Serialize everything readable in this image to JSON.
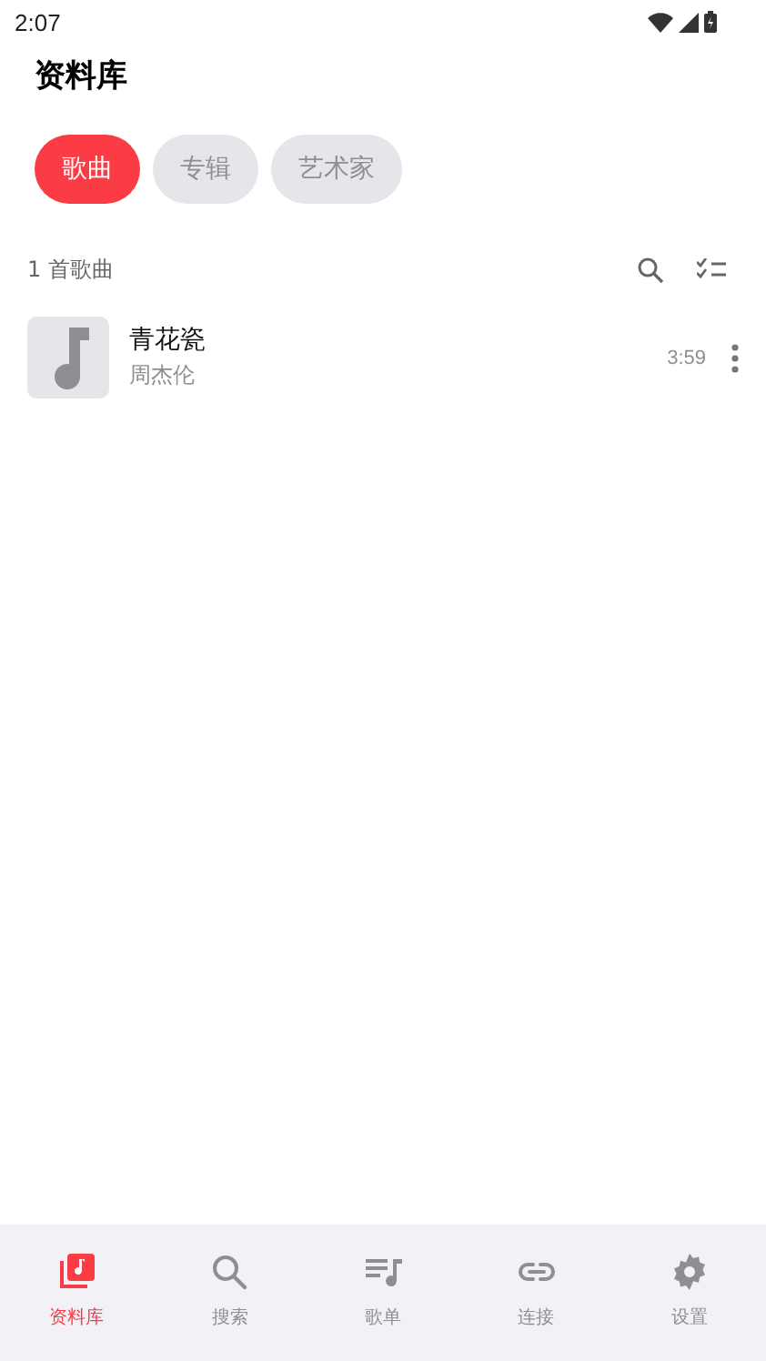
{
  "status_bar": {
    "time": "2:07"
  },
  "title": "资料库",
  "chips": [
    {
      "label": "歌曲",
      "selected": true
    },
    {
      "label": "专辑",
      "selected": false
    },
    {
      "label": "艺术家",
      "selected": false
    }
  ],
  "list_header": {
    "count": "1 首歌曲"
  },
  "songs": [
    {
      "title": "青花瓷",
      "artist": "周杰伦",
      "duration": "3:59"
    }
  ],
  "bottom_nav": [
    {
      "label": "资料库",
      "selected": true
    },
    {
      "label": "搜索",
      "selected": false
    },
    {
      "label": "歌单",
      "selected": false
    },
    {
      "label": "连接",
      "selected": false
    },
    {
      "label": "设置",
      "selected": false
    }
  ]
}
